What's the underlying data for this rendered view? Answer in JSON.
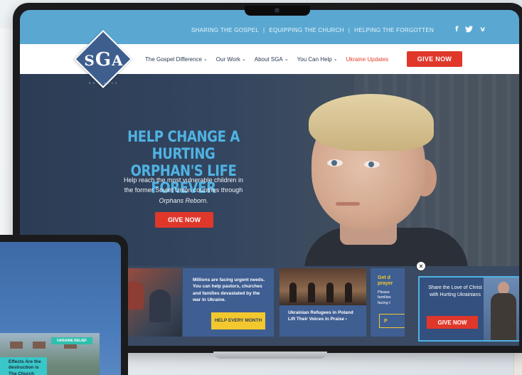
{
  "topbar": {
    "tagline": [
      "SHARING THE GOSPEL",
      "EQUIPPING THE CHURCH",
      "HELPING THE FORGOTTEN"
    ],
    "separator": "|",
    "socials": [
      {
        "icon": "facebook-icon",
        "glyph": "f"
      },
      {
        "icon": "twitter-icon",
        "glyph": "🐦"
      },
      {
        "icon": "vimeo-icon",
        "glyph": "v"
      }
    ]
  },
  "logo": {
    "s": "S",
    "g": "G",
    "a": "A",
    "left_mark": "EST",
    "right_mark": "1934"
  },
  "nav": {
    "items": [
      {
        "label": "The Gospel Difference",
        "chevron": "⌄"
      },
      {
        "label": "Our Work",
        "chevron": "⌄"
      },
      {
        "label": "About SGA",
        "chevron": "⌄"
      },
      {
        "label": "You Can Help",
        "chevron": "⌄"
      }
    ],
    "accent_item": "Ukraine Updates",
    "give_now": "GIVE NOW"
  },
  "hero": {
    "title_line1": "HELP CHANGE A HURTING",
    "title_line2": "ORPHAN'S LIFE FOREVER",
    "sub_line1": "Help reach the most vulnerable children in",
    "sub_line2": "the former Soviet Union countries through",
    "sub_em": "Orphans Reborn",
    "sub_end": ".",
    "button": "GIVE NOW"
  },
  "cards": {
    "card1_text": "Millions are facing urgent needs. You can help pastors, churches and families devastated by the war in Ukraine.",
    "card1_button": "HELP EVERY MONTH",
    "card2_text": "Ukrainian Refugees in Poland Lift Their Voices in Praise ›",
    "card3_title_1": "Get d",
    "card3_title_2": "prayer",
    "card3_text_1": "Please",
    "card3_text_2": "families",
    "card3_text_3": "facing t",
    "card3_button": "P"
  },
  "popup": {
    "close": "×",
    "text": "Share the Love of Christ with Hurting Ukrainians",
    "button": "GIVE NOW"
  },
  "tablet": {
    "badge": "UKRAINE RELIEF",
    "effects_text": "Effects Are the destruction is The Church ope. ›"
  },
  "colors": {
    "topbar": "#5aa8d2",
    "accent_red": "#e0372b",
    "hero_title": "#4fb3e3",
    "card_blue": "#3f5f93",
    "yellow": "#f2c82e",
    "logo_blue": "#3e5f8e"
  }
}
